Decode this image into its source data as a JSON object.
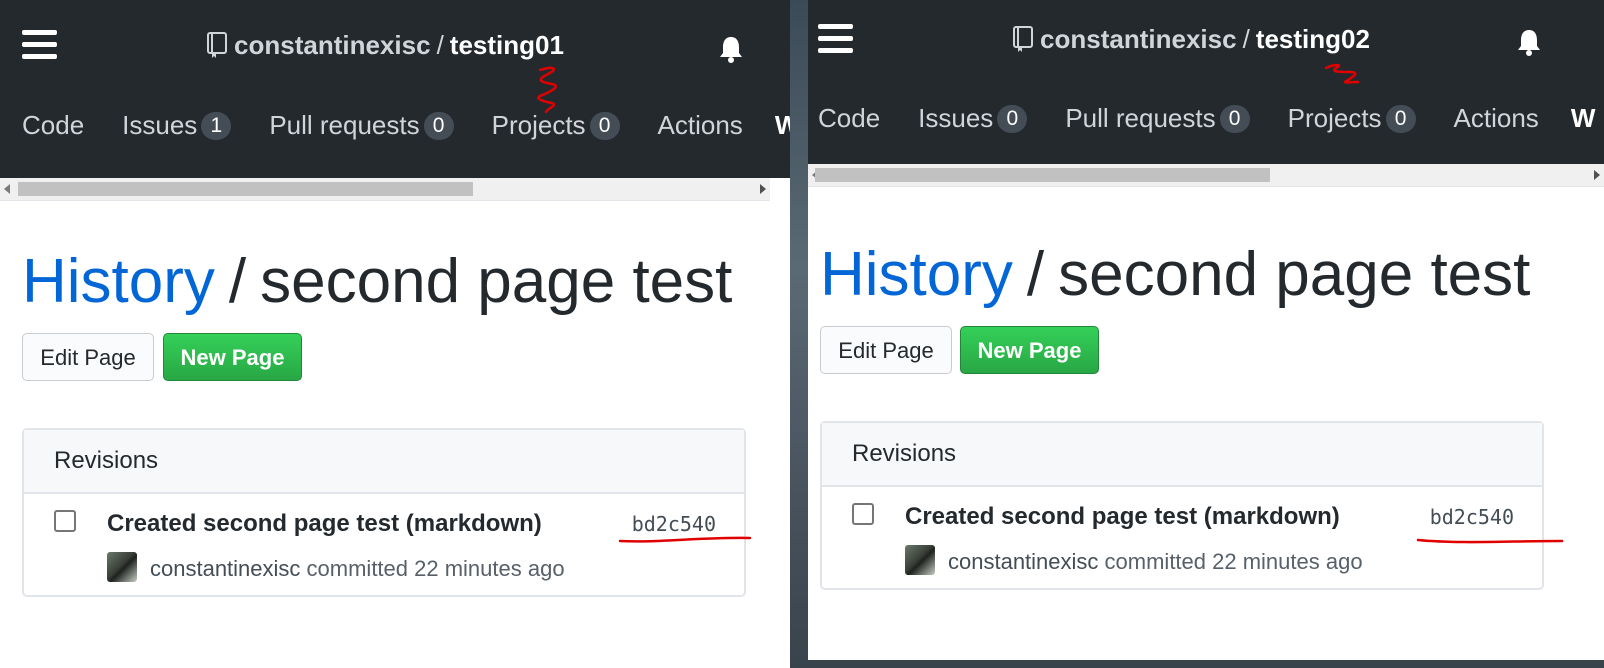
{
  "panes": [
    {
      "repo": {
        "owner": "constantinexisc",
        "separator": "/",
        "name": "testing01"
      },
      "nav_tabs": [
        {
          "label": "Code",
          "count": null
        },
        {
          "label": "Issues",
          "count": "1"
        },
        {
          "label": "Pull requests",
          "count": "0"
        },
        {
          "label": "Projects",
          "count": "0"
        },
        {
          "label": "Actions",
          "count": null
        }
      ],
      "nav_tab_cut": "W",
      "title": {
        "link": "History",
        "separator": "/",
        "page": "second page test"
      },
      "buttons": {
        "edit": "Edit Page",
        "new": "New Page"
      },
      "revisions": {
        "heading": "Revisions",
        "items": [
          {
            "message": "Created second page test (markdown)",
            "sha": "bd2c540",
            "author": "constantinexisc",
            "meta": "committed 22 minutes ago"
          }
        ]
      }
    },
    {
      "repo": {
        "owner": "constantinexisc",
        "separator": "/",
        "name": "testing02"
      },
      "nav_tabs": [
        {
          "label": "Code",
          "count": null
        },
        {
          "label": "Issues",
          "count": "0"
        },
        {
          "label": "Pull requests",
          "count": "0"
        },
        {
          "label": "Projects",
          "count": "0"
        },
        {
          "label": "Actions",
          "count": null
        }
      ],
      "nav_tab_cut": "W",
      "title": {
        "link": "History",
        "separator": "/",
        "page": "second page test"
      },
      "buttons": {
        "edit": "Edit Page",
        "new": "New Page"
      },
      "revisions": {
        "heading": "Revisions",
        "items": [
          {
            "message": "Created second page test (markdown)",
            "sha": "bd2c540",
            "author": "constantinexisc",
            "meta": "committed 22 minutes ago"
          }
        ]
      }
    }
  ],
  "icons": {
    "menu": "hamburger-icon",
    "repo": "repo-book-icon",
    "notifications": "bell-icon",
    "scroll_left": "arrow-left-icon",
    "scroll_right": "arrow-right-icon"
  },
  "colors": {
    "header_bg": "#24292e",
    "link": "#0366d6",
    "primary_button": "#28a745",
    "annotation": "#e00000"
  }
}
